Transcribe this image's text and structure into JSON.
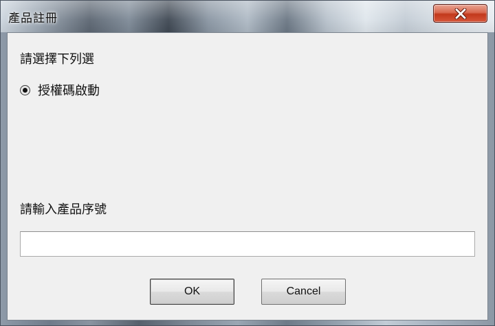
{
  "window": {
    "title": "產品註冊"
  },
  "titlebar": {
    "close_icon": "close-icon"
  },
  "dialog": {
    "prompt": "請選擇下列選",
    "options": [
      {
        "label": "授權碼啟動",
        "selected": true
      }
    ],
    "serial_label": "請輸入產品序號",
    "serial_value": "",
    "ok_label": "OK",
    "cancel_label": "Cancel"
  },
  "colors": {
    "close_button": "#c2391c",
    "client_background": "#f0f0f0"
  }
}
